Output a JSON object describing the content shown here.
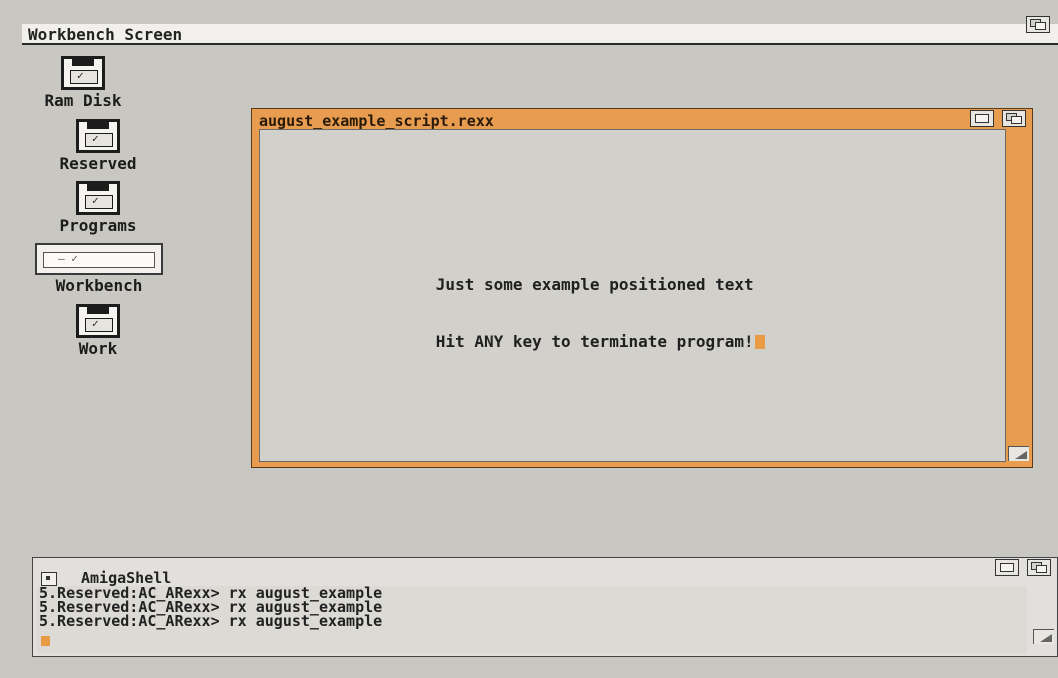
{
  "screen": {
    "title": "Workbench Screen"
  },
  "icons": [
    {
      "label": "Ram Disk",
      "type": "disk"
    },
    {
      "label": "Reserved",
      "type": "disk"
    },
    {
      "label": "Programs",
      "type": "disk"
    },
    {
      "label": "Workbench",
      "type": "drawer"
    },
    {
      "label": "Work",
      "type": "disk"
    }
  ],
  "rexx_window": {
    "title": "august_example_script.rexx",
    "line1": "Just some example positioned text",
    "line2": "Hit ANY key to terminate program!"
  },
  "shell": {
    "title": "AmigaShell",
    "lines": [
      "5.Reserved:AC_ARexx> rx august_example",
      "5.Reserved:AC_ARexx> rx august_example",
      "5.Reserved:AC_ARexx> rx august_example"
    ]
  },
  "colors": {
    "desktop": "#c9c7c2",
    "window_border_active": "#e79c4f",
    "cursor": "#e89a44"
  }
}
